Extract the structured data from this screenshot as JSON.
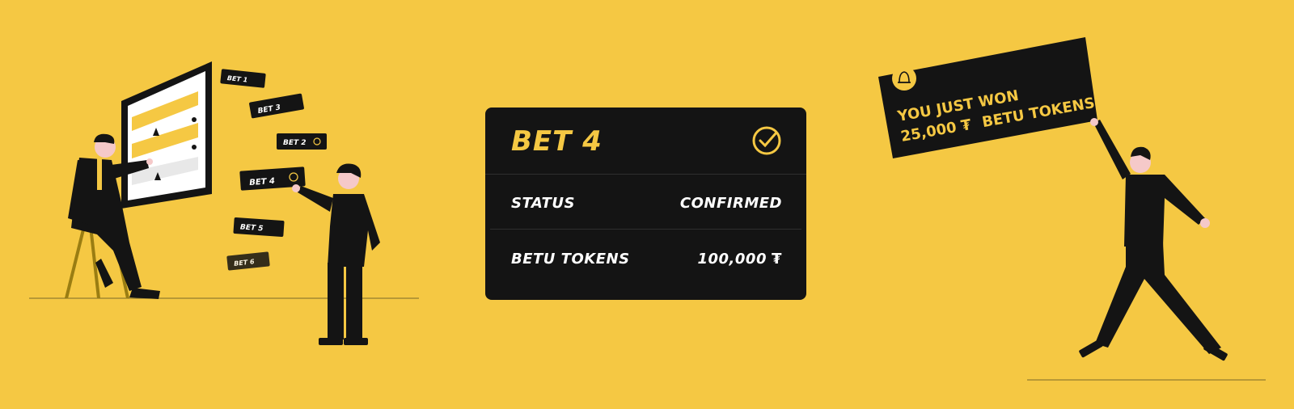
{
  "left_chips": [
    "BET 1",
    "BET 3",
    "BET 2",
    "BET 4",
    "BET 5",
    "BET 6"
  ],
  "card": {
    "title": "BET 4",
    "status_label": "STATUS",
    "status_value": "CONFIRMED",
    "tokens_label": "BETU TOKENS",
    "tokens_value": "100,000"
  },
  "win": {
    "line1": "YOU JUST WON",
    "amount": "25,000",
    "unit": "BETU TOKENS"
  },
  "colors": {
    "background": "#F5C843",
    "card": "#141414",
    "accent": "#F5C843"
  },
  "icons": [
    "check-circle-icon",
    "token-icon",
    "bell-icon"
  ]
}
